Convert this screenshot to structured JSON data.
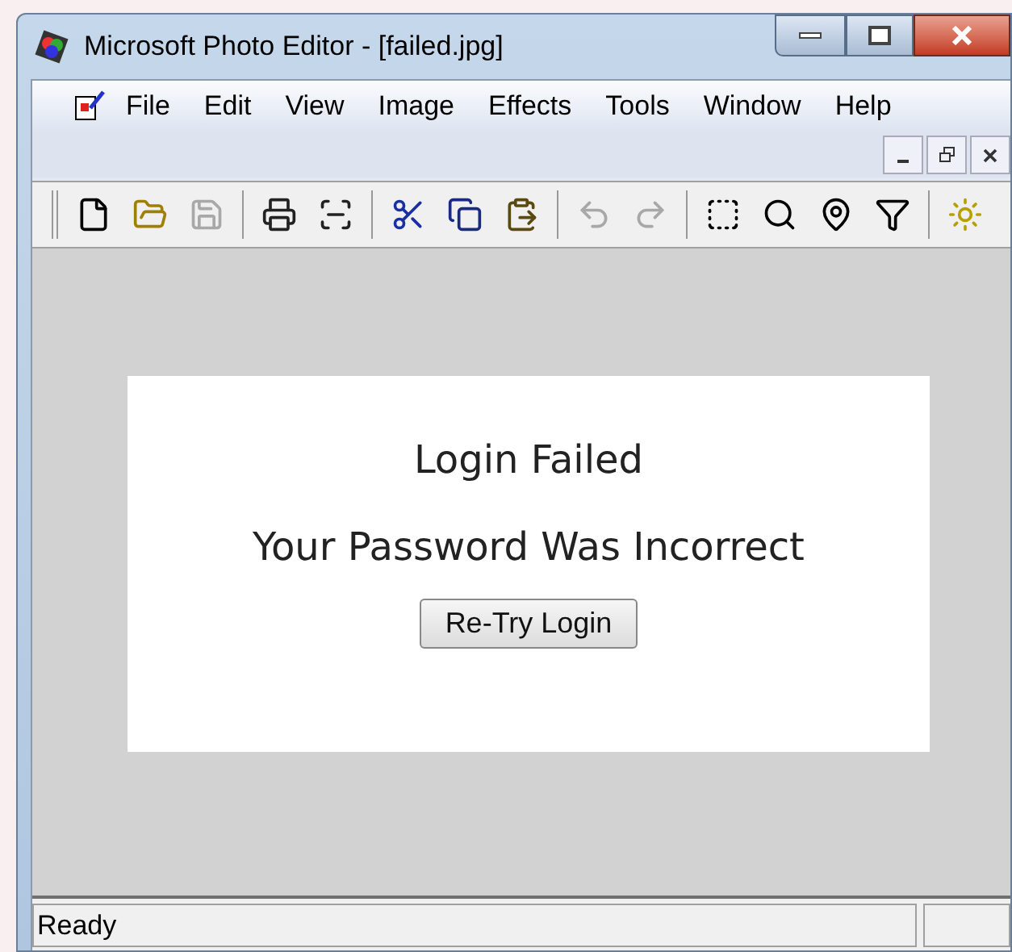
{
  "window": {
    "title": "Microsoft Photo Editor - [failed.jpg]"
  },
  "menu": [
    {
      "label": "File"
    },
    {
      "label": "Edit"
    },
    {
      "label": "View"
    },
    {
      "label": "Image"
    },
    {
      "label": "Effects"
    },
    {
      "label": "Tools"
    },
    {
      "label": "Window"
    },
    {
      "label": "Help"
    }
  ],
  "toolbar": [
    {
      "kind": "new",
      "disabled": false
    },
    {
      "kind": "open",
      "disabled": false
    },
    {
      "kind": "save",
      "disabled": true
    },
    {
      "kind": "sep"
    },
    {
      "kind": "print",
      "disabled": false
    },
    {
      "kind": "scan",
      "disabled": false
    },
    {
      "kind": "sep"
    },
    {
      "kind": "cut",
      "disabled": false
    },
    {
      "kind": "copy",
      "disabled": false
    },
    {
      "kind": "paste",
      "disabled": false
    },
    {
      "kind": "sep"
    },
    {
      "kind": "undo",
      "disabled": true
    },
    {
      "kind": "redo",
      "disabled": true
    },
    {
      "kind": "sep"
    },
    {
      "kind": "select",
      "disabled": false
    },
    {
      "kind": "zoom",
      "disabled": false
    },
    {
      "kind": "pin",
      "disabled": false
    },
    {
      "kind": "funnel",
      "disabled": false
    },
    {
      "kind": "sep"
    },
    {
      "kind": "sun",
      "disabled": false
    }
  ],
  "image": {
    "heading": "Login Failed",
    "message": "Your Password Was Incorrect",
    "button": "Re-Try Login"
  },
  "status_bar": {
    "text": "Ready"
  }
}
